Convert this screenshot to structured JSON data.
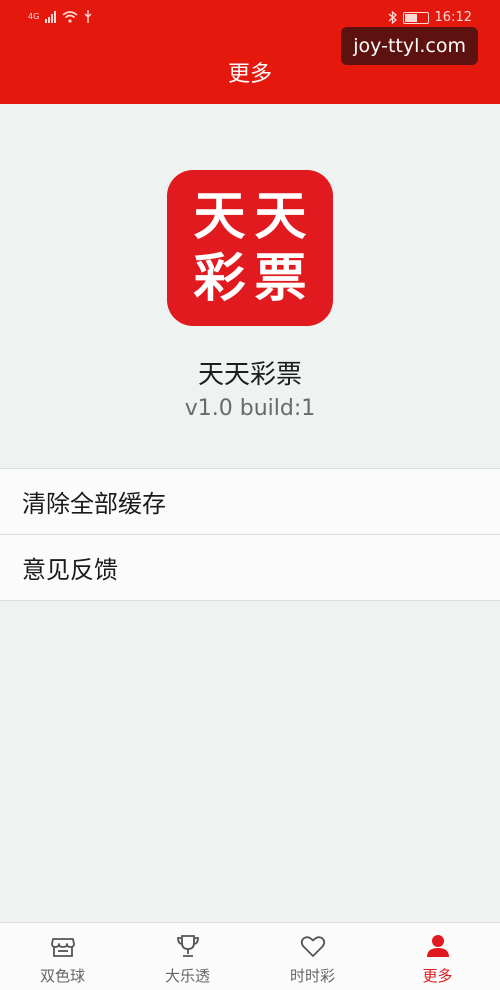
{
  "status_bar": {
    "network": "4G",
    "time": "16:12"
  },
  "watermark": "joy-ttyl.com",
  "header": {
    "title": "更多"
  },
  "app": {
    "logo_chars": [
      "天",
      "天",
      "彩",
      "票"
    ],
    "name": "天天彩票",
    "version": "v1.0 build:1"
  },
  "menu": {
    "items": [
      {
        "label": "清除全部缓存"
      },
      {
        "label": "意见反馈"
      }
    ]
  },
  "tabbar": {
    "tabs": [
      {
        "label": "双色球",
        "icon": "store-icon"
      },
      {
        "label": "大乐透",
        "icon": "trophy-icon"
      },
      {
        "label": "时时彩",
        "icon": "heart-icon"
      },
      {
        "label": "更多",
        "icon": "person-icon",
        "active": true
      }
    ]
  },
  "colors": {
    "brand_red": "#e5180d",
    "logo_red": "#e01a1f",
    "background": "#eef2f1"
  }
}
